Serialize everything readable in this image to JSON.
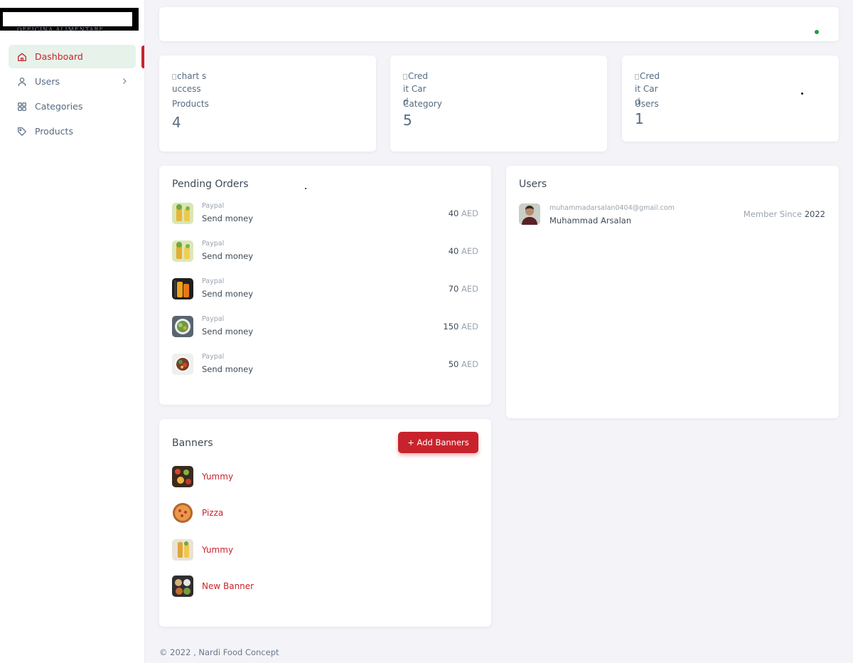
{
  "sidebar": {
    "brand_text": "OFFICINA ALIMENTARE",
    "items": [
      {
        "label": "Dashboard",
        "icon": "home-icon",
        "active": true
      },
      {
        "label": "Users",
        "icon": "user-icon",
        "has_submenu": true
      },
      {
        "label": "Categories",
        "icon": "grid-icon"
      },
      {
        "label": "Products",
        "icon": "tag-icon"
      }
    ]
  },
  "stats": [
    {
      "alt": "chart success",
      "label": "Products",
      "value": "4"
    },
    {
      "alt": "Credit Card",
      "label": "Category",
      "value": "5"
    },
    {
      "alt": "Credit Card",
      "label": "Users",
      "value": "1"
    }
  ],
  "pending_orders": {
    "title": "Pending Orders",
    "rows": [
      {
        "method": "Paypal",
        "desc": "Send money",
        "amount": "40",
        "currency": "AED"
      },
      {
        "method": "Paypal",
        "desc": "Send money",
        "amount": "40",
        "currency": "AED"
      },
      {
        "method": "Paypal",
        "desc": "Send money",
        "amount": "70",
        "currency": "AED"
      },
      {
        "method": "Paypal",
        "desc": "Send money",
        "amount": "150",
        "currency": "AED"
      },
      {
        "method": "Paypal",
        "desc": "Send money",
        "amount": "50",
        "currency": "AED"
      }
    ]
  },
  "users_panel": {
    "title": "Users",
    "rows": [
      {
        "email": "muhammadarsalan0404@gmail.com",
        "name": "Muhammad Arsalan",
        "since_label": "Member Since",
        "since_year": "2022"
      }
    ]
  },
  "banners": {
    "title": "Banners",
    "add_label": "+ Add Banners",
    "rows": [
      {
        "name": "Yummy"
      },
      {
        "name": "Pizza"
      },
      {
        "name": "Yummy"
      },
      {
        "name": "New Banner"
      }
    ]
  },
  "footer": {
    "text": "© 2022 , Nardi Food Concept"
  },
  "colors": {
    "accent": "#c8232c",
    "active_bg": "#e7f2ea",
    "status_online": "#1f9d46"
  }
}
